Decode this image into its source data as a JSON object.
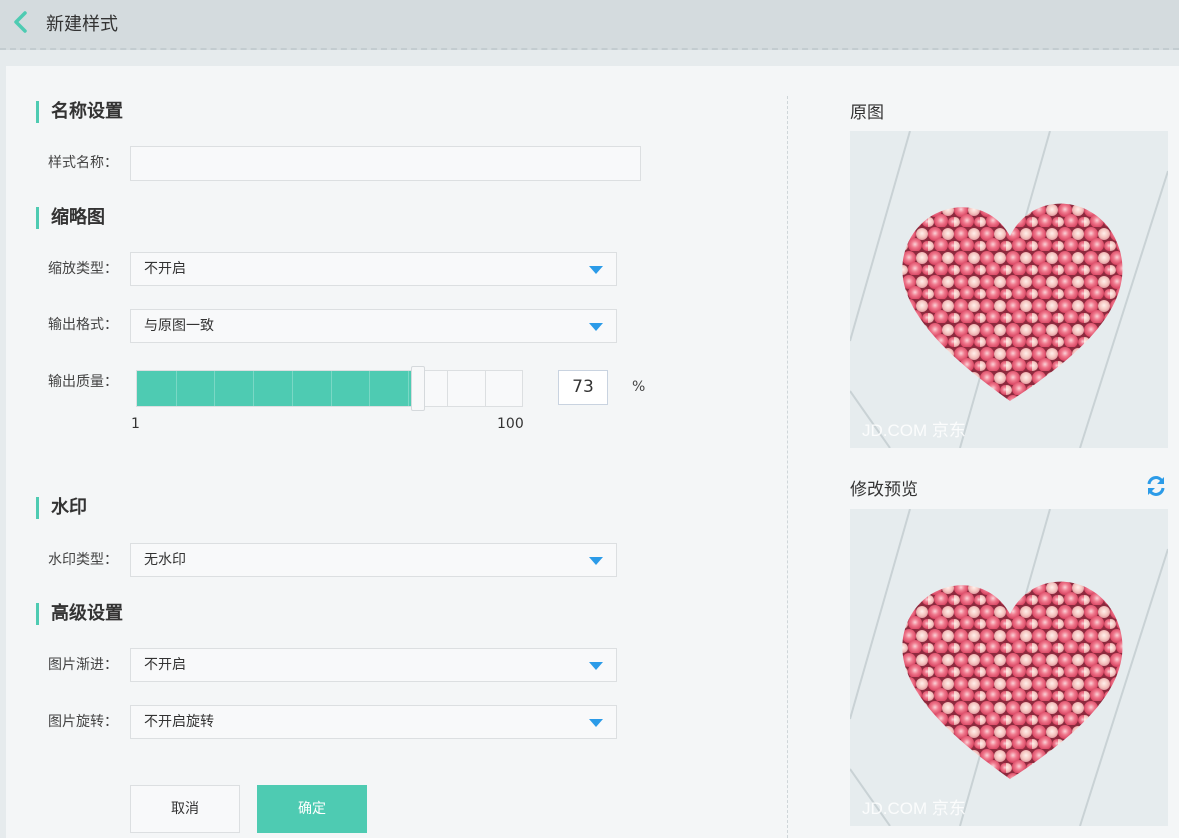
{
  "header": {
    "title": "新建样式",
    "back_icon": "chevron-left-icon"
  },
  "sections": {
    "name": {
      "title": "名称设置",
      "style_name_label": "样式名称：",
      "style_name_value": ""
    },
    "thumbnail": {
      "title": "缩略图",
      "scale_type_label": "缩放类型：",
      "scale_type_value": "不开启",
      "output_format_label": "输出格式：",
      "output_format_value": "与原图一致",
      "quality_label": "输出质量：",
      "quality_value": "73",
      "quality_min": "1",
      "quality_max": "100",
      "quality_unit": "%"
    },
    "watermark": {
      "title": "水印",
      "type_label": "水印类型：",
      "type_value": "无水印"
    },
    "advanced": {
      "title": "高级设置",
      "progressive_label": "图片渐进：",
      "progressive_value": "不开启",
      "rotate_label": "图片旋转：",
      "rotate_value": "不开启旋转"
    }
  },
  "actions": {
    "cancel_label": "取消",
    "confirm_label": "确定"
  },
  "preview": {
    "original_label": "原图",
    "modified_label": "修改预览",
    "watermark_text": "JD.COM 京东"
  },
  "colors": {
    "accent": "#4ecbb2",
    "arrow": "#2b9be8",
    "refresh": "#2b9be8"
  }
}
